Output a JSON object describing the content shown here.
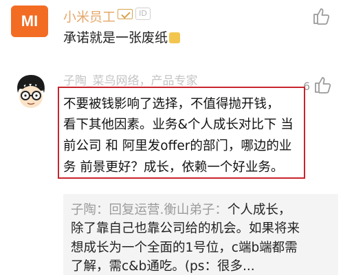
{
  "comment1": {
    "avatar_text": "MI",
    "username": "小米员工",
    "id_badge": "ID",
    "text": "承诺就是一张废纸",
    "like_icon": "thumbs-up-icon"
  },
  "comment2": {
    "username": "子陶_菜鸟网络，产品专家",
    "like_count": "6",
    "like_icon": "thumbs-up-icon",
    "body_lines": [
      "不要被钱影响了选择，不值得抛开钱，",
      "看下其他因素。业务&个人成长对比下 当",
      "前公司 和 阿里发offer的部门，哪边的业",
      "务 前景更好？成长，依赖一个好业务。"
    ],
    "reply": {
      "name": "子陶：回复运营.衡山弟子：",
      "lines": [
        "个人成长，",
        "除了靠自己也靠公司给的机会。如果将来",
        "想成长为一个全面的1号位，c端b端都需",
        "了解，需c&b通吃。(ps：很多..."
      ]
    }
  },
  "colors": {
    "highlight_border": "#c8232c",
    "mi_orange": "#f36c24",
    "username_gold": "#e5a76a"
  }
}
